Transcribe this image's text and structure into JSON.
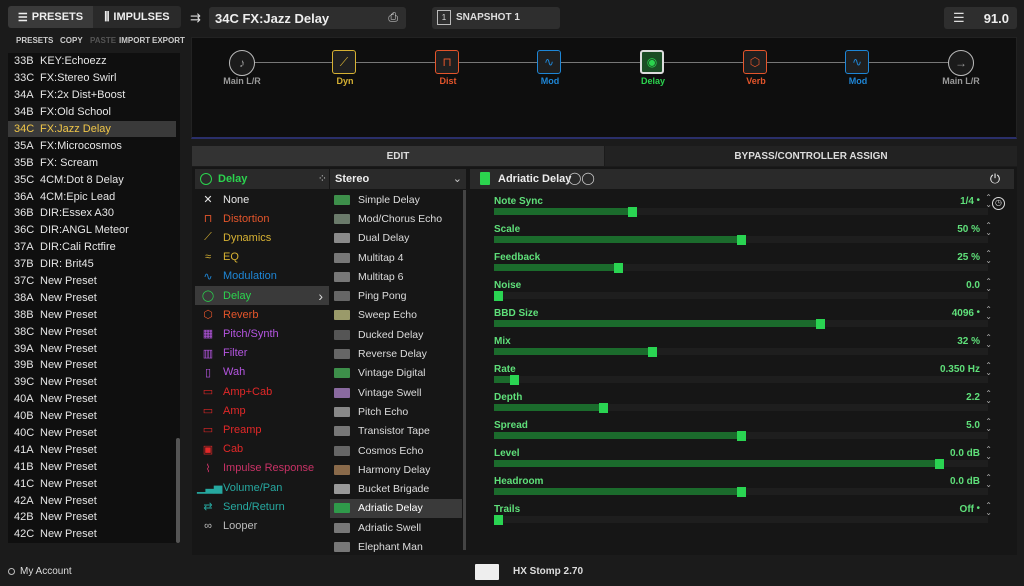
{
  "sidebar": {
    "tabs": [
      {
        "label": "PRESETS",
        "icon": "list-icon"
      },
      {
        "label": "IMPULSES",
        "icon": "waveform-icon"
      }
    ],
    "tools": {
      "title": "PRESETS",
      "copy": "COPY",
      "paste": "PASTE",
      "import": "IMPORT",
      "export": "EXPORT"
    },
    "presets": [
      {
        "num": "33B",
        "name": "KEY:Echoezz"
      },
      {
        "num": "33C",
        "name": "FX:Stereo Swirl"
      },
      {
        "num": "34A",
        "name": "FX:2x Dist+Boost"
      },
      {
        "num": "34B",
        "name": "FX:Old School"
      },
      {
        "num": "34C",
        "name": "FX:Jazz Delay"
      },
      {
        "num": "35A",
        "name": "FX:Microcosmos"
      },
      {
        "num": "35B",
        "name": "FX: Scream"
      },
      {
        "num": "35C",
        "name": "4CM:Dot 8 Delay"
      },
      {
        "num": "36A",
        "name": "4CM:Epic Lead"
      },
      {
        "num": "36B",
        "name": "DIR:Essex A30"
      },
      {
        "num": "36C",
        "name": "DIR:ANGL Meteor"
      },
      {
        "num": "37A",
        "name": "DIR:Cali Rctfire"
      },
      {
        "num": "37B",
        "name": "DIR: Brit45"
      },
      {
        "num": "37C",
        "name": "New Preset"
      },
      {
        "num": "38A",
        "name": "New Preset"
      },
      {
        "num": "38B",
        "name": "New Preset"
      },
      {
        "num": "38C",
        "name": "New Preset"
      },
      {
        "num": "39A",
        "name": "New Preset"
      },
      {
        "num": "39B",
        "name": "New Preset"
      },
      {
        "num": "39C",
        "name": "New Preset"
      },
      {
        "num": "40A",
        "name": "New Preset"
      },
      {
        "num": "40B",
        "name": "New Preset"
      },
      {
        "num": "40C",
        "name": "New Preset"
      },
      {
        "num": "41A",
        "name": "New Preset"
      },
      {
        "num": "41B",
        "name": "New Preset"
      },
      {
        "num": "41C",
        "name": "New Preset"
      },
      {
        "num": "42A",
        "name": "New Preset"
      },
      {
        "num": "42B",
        "name": "New Preset"
      },
      {
        "num": "42C",
        "name": "New Preset"
      }
    ],
    "selected_index": 4
  },
  "header": {
    "preset_name": "34C  FX:Jazz Delay",
    "snapshot": "SNAPSHOT 1",
    "tempo": "91.0"
  },
  "chain": {
    "blocks": [
      {
        "label": "Main L/R",
        "color": "#999999",
        "icon": "guitar-icon",
        "type": "io"
      },
      {
        "label": "Dyn",
        "color": "#d6b133",
        "icon": "dynamics-icon"
      },
      {
        "label": "Dist",
        "color": "#e4552b",
        "icon": "distortion-icon"
      },
      {
        "label": "Mod",
        "color": "#1e86d6",
        "icon": "modulation-icon"
      },
      {
        "label": "Delay",
        "color": "#2bd44e",
        "icon": "delay-icon",
        "selected": true
      },
      {
        "label": "Verb",
        "color": "#e4552b",
        "icon": "reverb-icon"
      },
      {
        "label": "Mod",
        "color": "#1e86d6",
        "icon": "modulation-icon"
      },
      {
        "label": "Main L/R",
        "color": "#999999",
        "icon": "output-arrow-icon",
        "type": "io"
      }
    ]
  },
  "edit_tabs": {
    "edit": "EDIT",
    "bypass": "BYPASS/CONTROLLER ASSIGN"
  },
  "categories": {
    "header": "Delay",
    "items": [
      {
        "label": "None",
        "color": "#e6e6e6",
        "icon": "x-icon"
      },
      {
        "label": "Distortion",
        "color": "#e4552b",
        "icon": "distortion-icon"
      },
      {
        "label": "Dynamics",
        "color": "#d6b133",
        "icon": "dynamics-icon"
      },
      {
        "label": "EQ",
        "color": "#d6b133",
        "icon": "eq-icon"
      },
      {
        "label": "Modulation",
        "color": "#1e86d6",
        "icon": "modulation-icon"
      },
      {
        "label": "Delay",
        "color": "#2bd44e",
        "icon": "delay-icon",
        "selected": true
      },
      {
        "label": "Reverb",
        "color": "#e4552b",
        "icon": "reverb-icon"
      },
      {
        "label": "Pitch/Synth",
        "color": "#b455e0",
        "icon": "pitch-icon"
      },
      {
        "label": "Filter",
        "color": "#b455e0",
        "icon": "filter-icon"
      },
      {
        "label": "Wah",
        "color": "#b455e0",
        "icon": "wah-icon"
      },
      {
        "label": "Amp+Cab",
        "color": "#e22828",
        "icon": "amp-cab-icon"
      },
      {
        "label": "Amp",
        "color": "#e22828",
        "icon": "amp-icon"
      },
      {
        "label": "Preamp",
        "color": "#e22828",
        "icon": "preamp-icon"
      },
      {
        "label": "Cab",
        "color": "#e22828",
        "icon": "cab-icon"
      },
      {
        "label": "Impulse Response",
        "color": "#c83266",
        "icon": "impulse-response-icon"
      },
      {
        "label": "Volume/Pan",
        "color": "#26a8a0",
        "icon": "volume-icon"
      },
      {
        "label": "Send/Return",
        "color": "#26a8a0",
        "icon": "send-return-icon"
      },
      {
        "label": "Looper",
        "color": "#bbbbbb",
        "icon": "looper-icon"
      }
    ]
  },
  "models": {
    "header": "Stereo",
    "items": [
      "Simple Delay",
      "Mod/Chorus Echo",
      "Dual Delay",
      "Multitap 4",
      "Multitap 6",
      "Ping Pong",
      "Sweep Echo",
      "Ducked Delay",
      "Reverse Delay",
      "Vintage Digital",
      "Vintage Swell",
      "Pitch Echo",
      "Transistor Tape",
      "Cosmos Echo",
      "Harmony Delay",
      "Bucket Brigade",
      "Adriatic Delay",
      "Adriatic Swell",
      "Elephant Man"
    ],
    "selected_index": 16
  },
  "block_editor": {
    "model_name": "Adriatic Delay",
    "params": [
      {
        "name": "Note Sync",
        "value": "1/4",
        "level": 0.28,
        "dot": true
      },
      {
        "name": "Scale",
        "value": "50 %",
        "level": 0.5
      },
      {
        "name": "Feedback",
        "value": "25 %",
        "level": 0.25
      },
      {
        "name": "Noise",
        "value": "0.0",
        "level": 0.0
      },
      {
        "name": "BBD Size",
        "value": "4096",
        "level": 0.66,
        "dot": true
      },
      {
        "name": "Mix",
        "value": "32 %",
        "level": 0.32
      },
      {
        "name": "Rate",
        "value": "0.350 Hz",
        "level": 0.04
      },
      {
        "name": "Depth",
        "value": "2.2",
        "level": 0.22
      },
      {
        "name": "Spread",
        "value": "5.0",
        "level": 0.5
      },
      {
        "name": "Level",
        "value": "0.0 dB",
        "level": 0.9
      },
      {
        "name": "Headroom",
        "value": "0.0 dB",
        "level": 0.5
      },
      {
        "name": "Trails",
        "value": "Off",
        "level": 0.0,
        "dot": true
      }
    ]
  },
  "footer": {
    "account": "My Account",
    "device": "HX Stomp 2.70"
  },
  "colors": {
    "accent": "#2bd44e",
    "selected_preset": "#f0c648",
    "chain_border": "#2a2f6a"
  }
}
